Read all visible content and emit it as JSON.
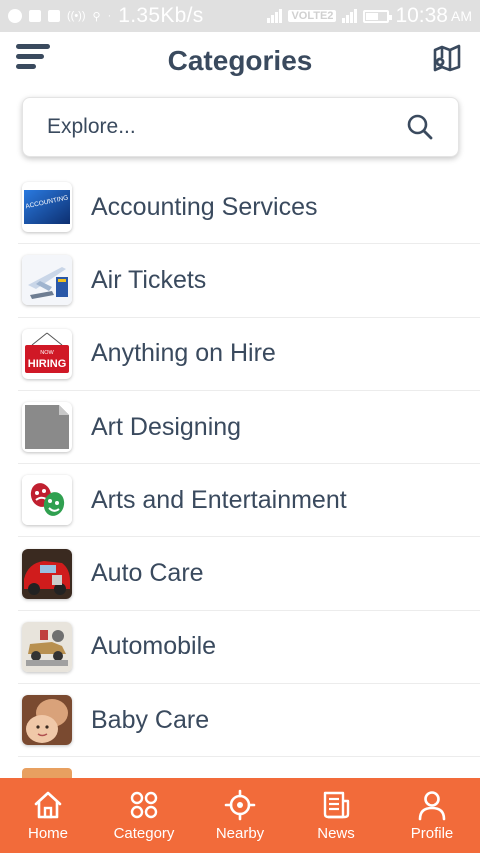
{
  "status_bar": {
    "speed": "1.35Kb/s",
    "volte": "VOLTE2",
    "time": "10:38",
    "ampm": "AM"
  },
  "header": {
    "title": "Categories",
    "menu_icon": "menu-icon",
    "map_icon": "map-icon"
  },
  "search": {
    "placeholder": "Explore...",
    "icon": "search-icon"
  },
  "categories": [
    {
      "label": "Accounting Services",
      "thumb_text": "ACCOUNTING SERVICES"
    },
    {
      "label": "Air Tickets"
    },
    {
      "label": "Anything on Hire",
      "thumb_text_1": "NOW",
      "thumb_text_2": "HIRING"
    },
    {
      "label": "Art Designing"
    },
    {
      "label": "Arts and Entertainment"
    },
    {
      "label": "Auto Care"
    },
    {
      "label": "Automobile"
    },
    {
      "label": "Baby Care"
    }
  ],
  "bottom_nav": [
    {
      "label": "Home",
      "icon": "home-icon"
    },
    {
      "label": "Category",
      "icon": "category-icon"
    },
    {
      "label": "Nearby",
      "icon": "nearby-icon"
    },
    {
      "label": "News",
      "icon": "news-icon"
    },
    {
      "label": "Profile",
      "icon": "profile-icon"
    }
  ],
  "colors": {
    "accent": "#f26b3a",
    "text": "#3a4a5e"
  }
}
